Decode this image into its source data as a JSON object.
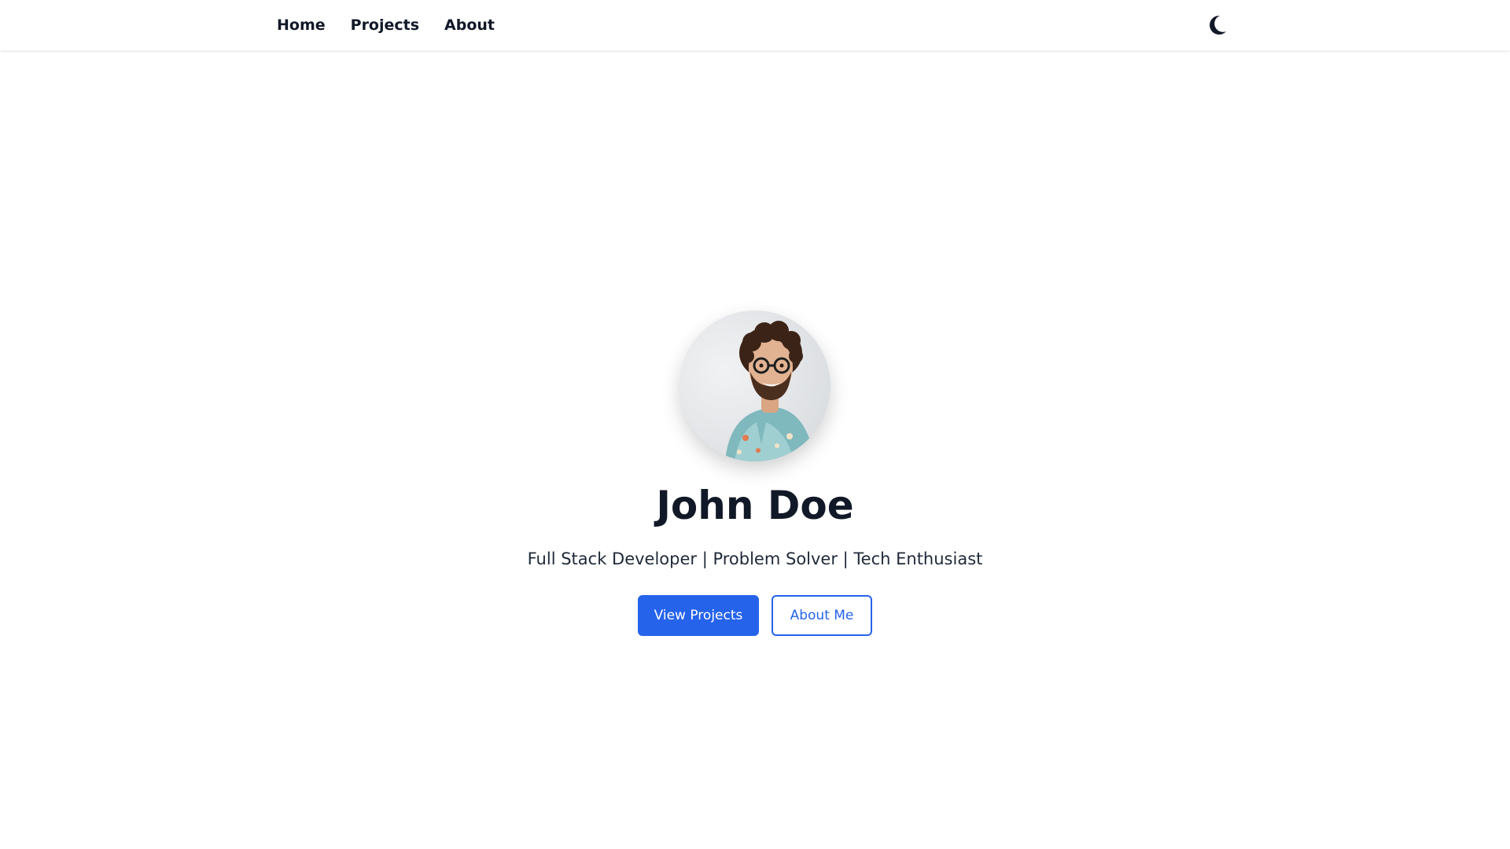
{
  "nav": {
    "links": [
      {
        "label": "Home"
      },
      {
        "label": "Projects"
      },
      {
        "label": "About"
      }
    ],
    "theme_toggle_icon": "moon-icon"
  },
  "hero": {
    "avatar_icon": "profile-photo",
    "name": "John Doe",
    "tagline": "Full Stack Developer | Problem Solver | Tech Enthusiast",
    "primary_button": "View Projects",
    "secondary_button": "About Me"
  },
  "colors": {
    "accent": "#2563eb",
    "text": "#111827",
    "background": "#ffffff"
  }
}
